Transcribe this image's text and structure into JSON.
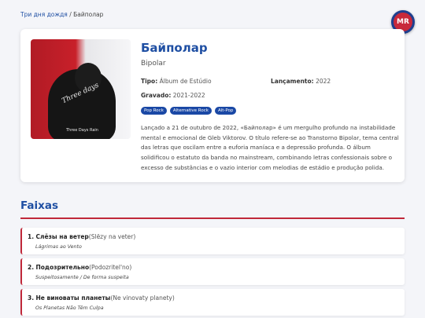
{
  "breadcrumb": {
    "parent": "Три дня дождя",
    "separator": " / ",
    "current": "Байполар"
  },
  "logo": {
    "text": "MR",
    "colors": {
      "fill": "#c8293b",
      "ring": "#1e3f8f"
    }
  },
  "album": {
    "title": "Байполар",
    "subtitle": "Bipolar",
    "type_label": "Tipo:",
    "type_value": "Álbum de Estúdio",
    "release_label": "Lançamento:",
    "release_value": "2022",
    "recorded_label": "Gravado:",
    "recorded_value": "2021-2022",
    "tags": [
      "Pop Rock",
      "Alternative Rock",
      "Alt-Pop"
    ],
    "description": "Lançado a 21 de outubro de 2022, «Байполар» é um mergulho profundo na instabilidade mental e emocional de Gleb Viktorov. O título refere-se ao Transtorno Bipolar, tema central das letras que oscilam entre a euforia maníaca e a depressão profunda. O álbum solidificou o estatuto da banda no mainstream, combinando letras confessionais sobre o excesso de substâncias e o vazio interior com melodias de estádio e produção polida."
  },
  "cover": {
    "script_text": "Three days",
    "badge_text": "Three Days Rain"
  },
  "tracks_section": {
    "title": "Faixas"
  },
  "tracks": [
    {
      "number": "1.",
      "title": "Слёзы на ветер",
      "translit": "(Slëzy na veter)",
      "translation": "Lágrimas ao Vento"
    },
    {
      "number": "2.",
      "title": "Подозрительно",
      "translit": "(Podozritel'no)",
      "translation": "Suspeitosamente / De forma suspeita"
    },
    {
      "number": "3.",
      "title": "Не виноваты планеты",
      "translit": "(Ne vinovaty planety)",
      "translation": "Os Planetas Não Têm Culpa"
    }
  ],
  "colors": {
    "accent": "#1f4fa3",
    "rule": "#c0283a",
    "tag": "#1a48a5"
  }
}
